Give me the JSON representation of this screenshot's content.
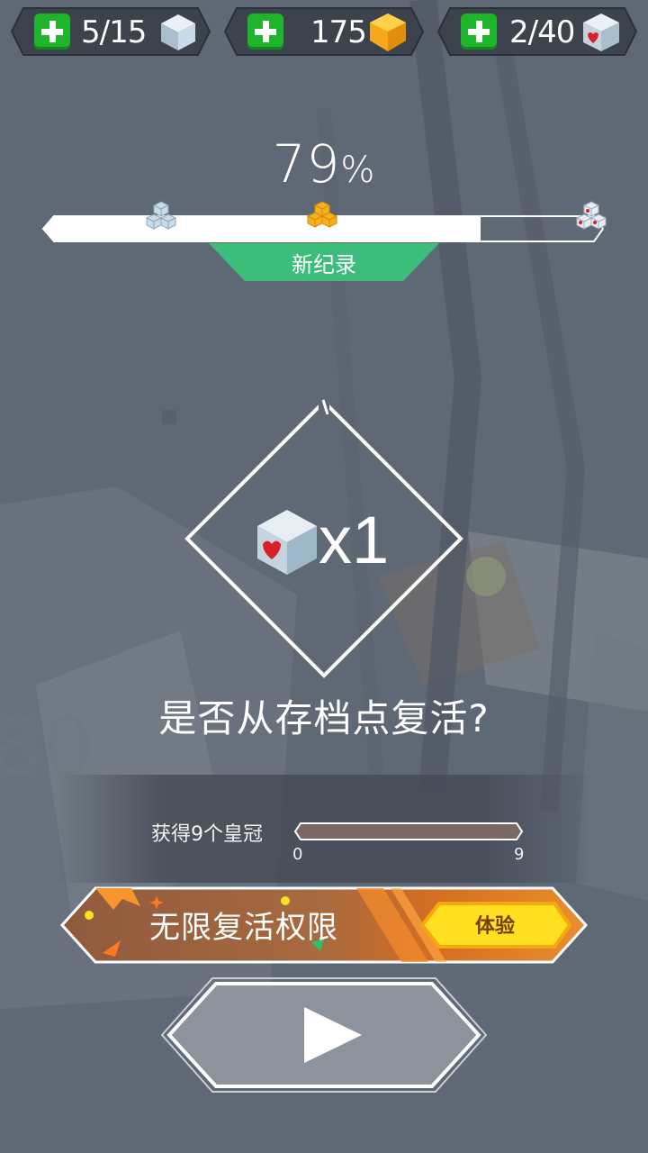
{
  "resources": [
    {
      "label": "5/15",
      "icon": "ice-cube-icon"
    },
    {
      "label": "175",
      "icon": "gold-gem-icon"
    },
    {
      "label": "2/40",
      "icon": "heart-cube-icon"
    }
  ],
  "progress": {
    "value": "79",
    "unit": "%",
    "fraction": 0.79,
    "record_label": "新纪录"
  },
  "revive": {
    "count": "x1",
    "question": "是否从存档点复活?"
  },
  "crown_progress": {
    "label": "获得9个皇冠",
    "min": "0",
    "max": "9",
    "value": 0
  },
  "promo": {
    "title": "无限复活权限",
    "button_label": "体验"
  },
  "colors": {
    "green": "#1fb52a",
    "record": "#3dbd7a",
    "gold": "#f7b21b",
    "promo": "#e67a2a",
    "try": "#ffe021"
  }
}
